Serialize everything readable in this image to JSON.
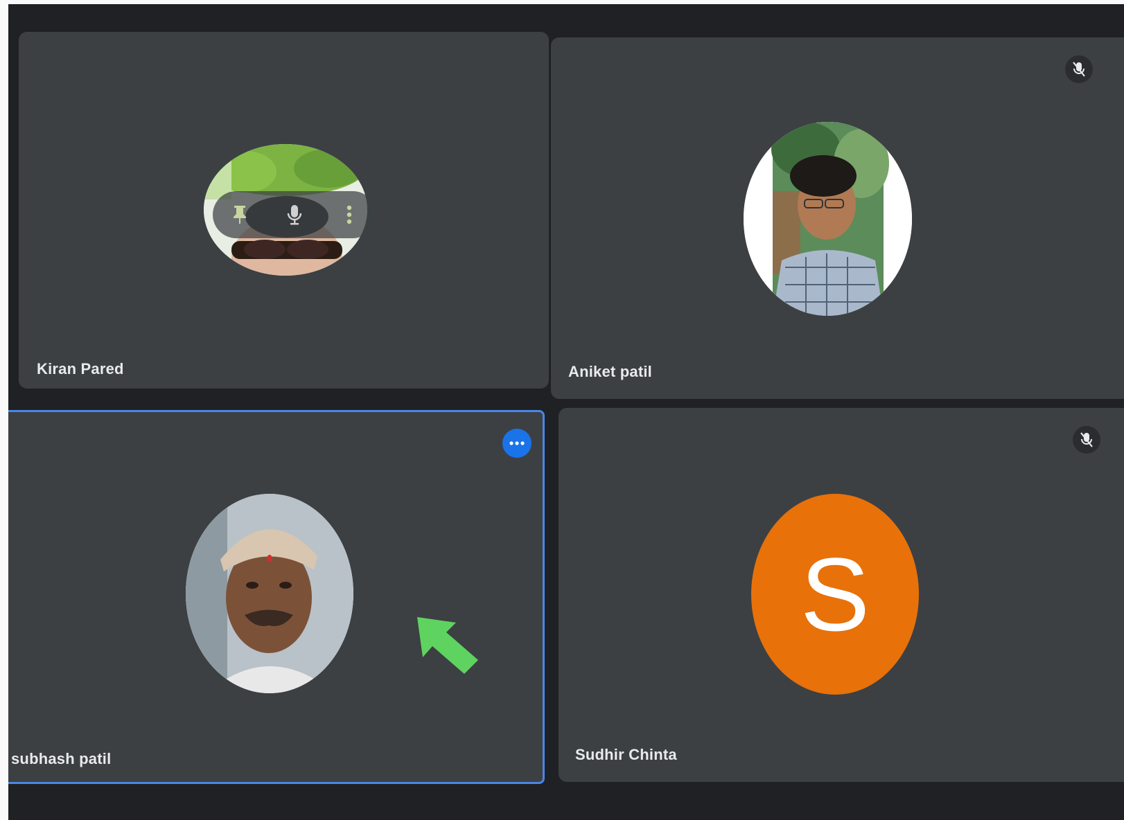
{
  "participants": [
    {
      "name": "Kiran Pared"
    },
    {
      "name": "Aniket patil"
    },
    {
      "name": "subhash patil"
    },
    {
      "name": "Sudhir Chinta",
      "initial": "S",
      "avatar_color": "#e8710a"
    }
  ],
  "icons": {
    "pin": "pin-icon",
    "mic": "mic-icon",
    "more_vert": "more-vert-icon",
    "mic_off": "mic-off-icon",
    "more_horiz": "more-horiz-icon",
    "arrow": "arrow-annotation"
  },
  "colors": {
    "stage_bg": "#202124",
    "tile_bg": "#3c4043",
    "active_border": "#4a86e8",
    "more_button": "#1a73e8",
    "annotation_arrow": "#5fd35f"
  }
}
